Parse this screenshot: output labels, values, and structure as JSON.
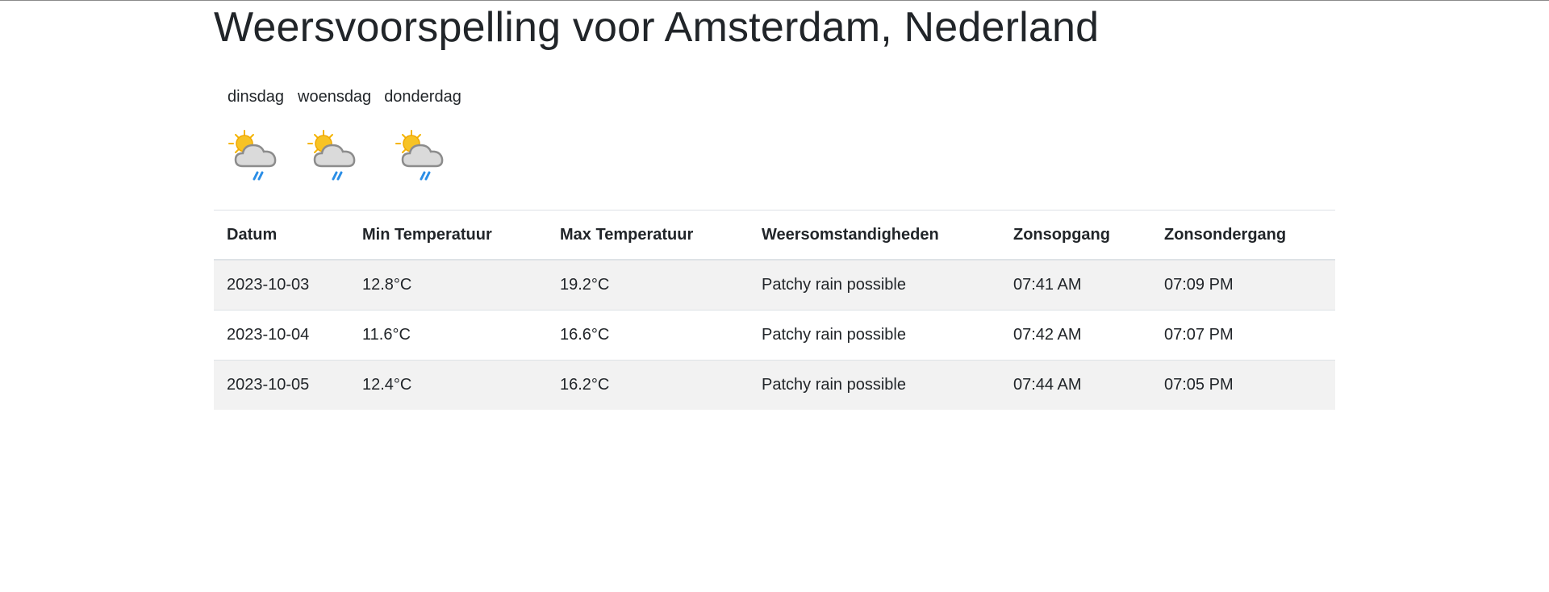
{
  "page": {
    "title": "Weersvoorspelling voor Amsterdam, Nederland"
  },
  "forecast": {
    "days": [
      {
        "label": "dinsdag",
        "icon": "patchy-rain-icon"
      },
      {
        "label": "woensdag",
        "icon": "patchy-rain-icon"
      },
      {
        "label": "donderdag",
        "icon": "patchy-rain-icon"
      }
    ]
  },
  "table": {
    "headers": [
      "Datum",
      "Min Temperatuur",
      "Max Temperatuur",
      "Weersomstandigheden",
      "Zonsopgang",
      "Zonsondergang"
    ],
    "rows": [
      [
        "2023-10-03",
        "12.8°C",
        "19.2°C",
        "Patchy rain possible",
        "07:41 AM",
        "07:09 PM"
      ],
      [
        "2023-10-04",
        "11.6°C",
        "16.6°C",
        "Patchy rain possible",
        "07:42 AM",
        "07:07 PM"
      ],
      [
        "2023-10-05",
        "12.4°C",
        "16.2°C",
        "Patchy rain possible",
        "07:44 AM",
        "07:05 PM"
      ]
    ]
  },
  "colors": {
    "text": "#212529",
    "stripe": "#f2f2f2",
    "border": "#dee2e6",
    "sun": "#f5b400",
    "cloud": "#d9d9d9",
    "rain": "#2b8ee6"
  }
}
